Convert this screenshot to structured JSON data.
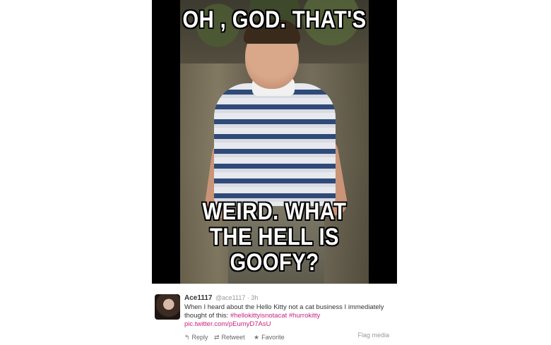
{
  "meme": {
    "top_text": "OH , GOD. THAT'S",
    "bottom_line1": "WEIRD. WHAT",
    "bottom_line2": "THE HELL IS",
    "bottom_line3": "GOOFY?"
  },
  "tweet": {
    "author_name": "Ace1117",
    "handle": "@ace1117",
    "separator": "·",
    "time": "3h",
    "text_part1": "When I heard about the Hello Kitty not a cat business I immediately thought of this:",
    "hashtag1": "#hellokittyisnotacat",
    "hashtag2": "#hurrokitty",
    "media_link": "pic.twitter.com/pEumyD7AsU",
    "actions": {
      "reply_icon": "reply-icon",
      "reply_glyph": "↰",
      "reply_label": "Reply",
      "retweet_icon": "retweet-icon",
      "retweet_glyph": "⇄",
      "retweet_label": "Retweet",
      "favorite_icon": "star-icon",
      "favorite_glyph": "★",
      "favorite_label": "Favorite"
    },
    "flag_media_label": "Flag media"
  },
  "colors": {
    "hashtag": "#c9227e",
    "frame": "#000000"
  }
}
